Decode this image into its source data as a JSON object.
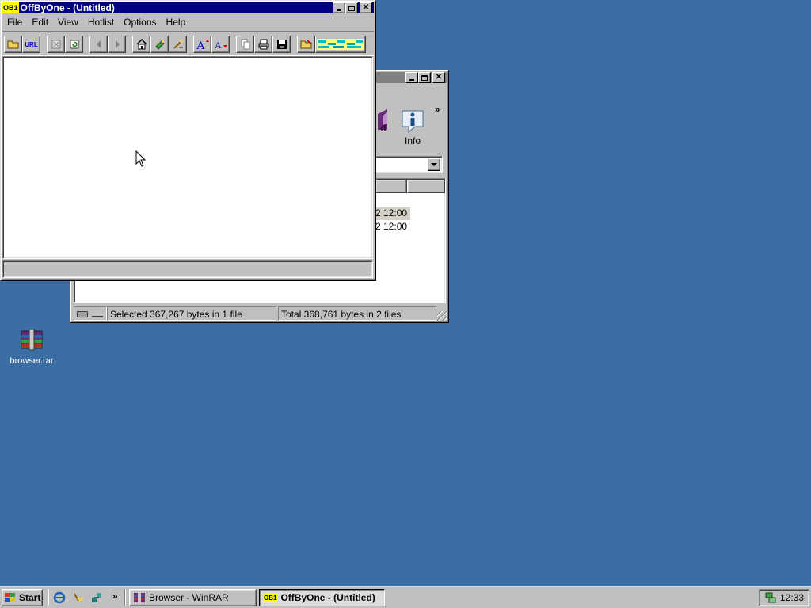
{
  "desktop": {
    "icons": [
      {
        "label": "browser.rar",
        "icon": "winrar-archive-icon"
      }
    ]
  },
  "winrar": {
    "toolbar": {
      "info_label": "Info",
      "partial_label": "d"
    },
    "file_times": [
      "2 12:00",
      "2 12:00"
    ],
    "status": {
      "selected": "Selected 367,267 bytes in 1 file",
      "total": "Total 368,761 bytes in 2 files"
    }
  },
  "offbyone": {
    "title": "OffByOne - (Untitled)",
    "app_badge": "OB1",
    "menu": [
      {
        "label": "File",
        "accel": "F"
      },
      {
        "label": "Edit",
        "accel": "E"
      },
      {
        "label": "View",
        "accel": "V"
      },
      {
        "label": "Hotlist",
        "accel": "l"
      },
      {
        "label": "Options",
        "accel": "O"
      },
      {
        "label": "Help",
        "accel": "H"
      }
    ],
    "toolbar_icons": [
      "open-folder-icon",
      "url-icon",
      "stop-icon",
      "reload-icon",
      "back-icon",
      "forward-icon",
      "home-icon",
      "bookmark-icon",
      "search-icon",
      "font-larger-icon",
      "font-smaller-icon",
      "copy-icon",
      "print-icon",
      "save-icon",
      "image-toggle-icon",
      "color-bar-icon"
    ],
    "url_label": "URL"
  },
  "taskbar": {
    "start_label": "Start",
    "tasks": [
      {
        "label": "Browser - WinRAR",
        "active": false
      },
      {
        "label": "OffByOne - (Untitled)",
        "active": true
      }
    ],
    "clock": "12:33"
  }
}
